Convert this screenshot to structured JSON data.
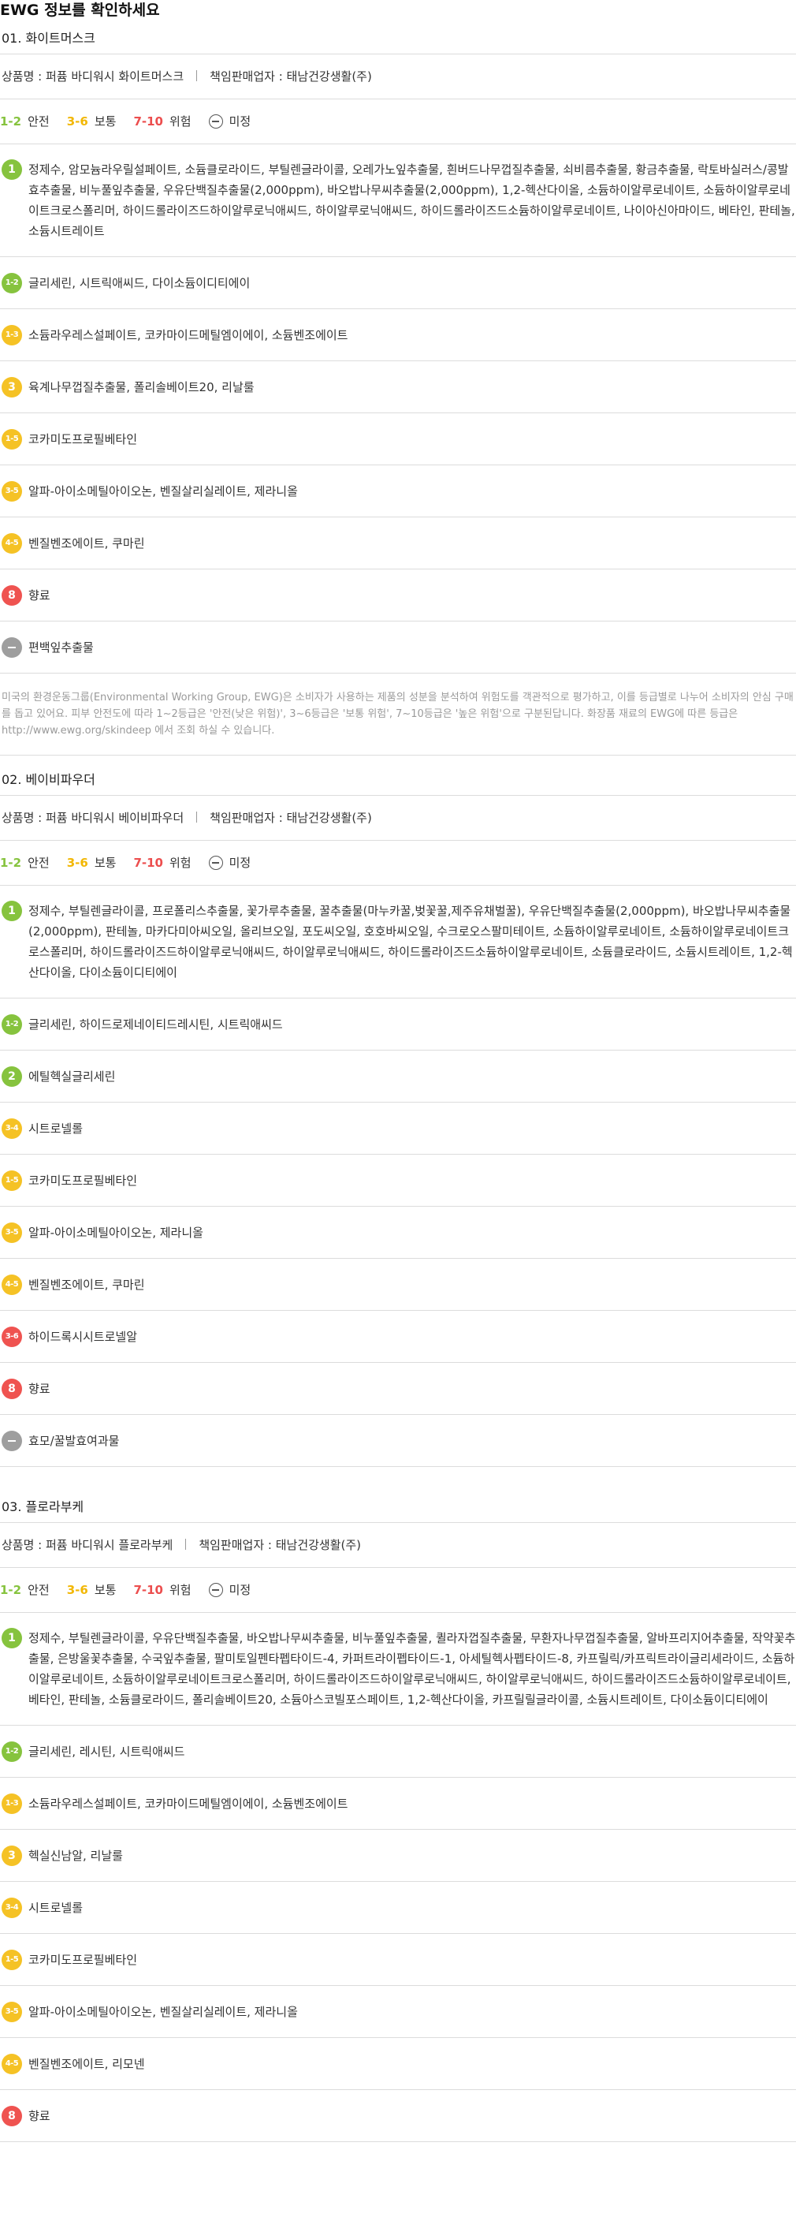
{
  "page_title": "EWG 정보를 확인하세요",
  "legend": {
    "safe_range": "1-2",
    "safe_label": "안전",
    "medium_range": "3-6",
    "medium_label": "보통",
    "danger_range": "7-10",
    "danger_label": "위험",
    "undetermined_label": "미정"
  },
  "colors": {
    "green": "#86c33e",
    "yellow": "#f5c225",
    "red": "#ef5350",
    "gray": "#9e9e9e"
  },
  "note": "미국의 환경운동그룹(Environmental Working Group, EWG)은 소비자가 사용하는 제품의 성분을 분석하여 위험도를 객관적으로 평가하고, 이를 등급별로 나누어 소비자의 안심 구매를 돕고 있어요. 피부 안전도에 따라 1~2등급은 '안전(낮은 위험)', 3~6등급은 '보통 위험', 7~10등급은 '높은 위험'으로 구분된답니다. 화장품 재료의 EWG에 따른 등급은 http://www.ewg.org/skindeep 에서 조회 하실 수 있습니다.",
  "sections": [
    {
      "heading": "01. 화이트머스크",
      "product": "상품명 : 퍼퓸 바디워시 화이트머스크",
      "seller": "책임판매업자 : 태남건강생활(주)",
      "rows": [
        {
          "grade": "1",
          "color": "green",
          "text": "정제수, 암모늄라우릴설페이트, 소듐클로라이드, 부틸렌글라이콜, 오레가노잎추출물, 흰버드나무껍질추출물, 쇠비름추출물, 황금추출물, 락토바실러스/콩발효추출물, 비누풀잎추출물, 우유단백질추출물(2,000ppm), 바오밥나무씨추출물(2,000ppm), 1,2-헥산다이올, 소듐하이알루로네이트, 소듐하이알루로네이트크로스폴리머, 하이드롤라이즈드하이알루로닉애씨드, 하이알루로닉애씨드, 하이드롤라이즈드소듐하이알루로네이트, 나이아신아마이드, 베타인, 판테놀, 소듐시트레이트"
        },
        {
          "grade": "1-2",
          "color": "green",
          "text": "글리세린, 시트릭애씨드, 다이소듐이디티에이"
        },
        {
          "grade": "1-3",
          "color": "yellow",
          "text": "소듐라우레스설페이트, 코카마이드메틸엠이에이, 소듐벤조에이트"
        },
        {
          "grade": "3",
          "color": "yellow",
          "text": "육계나무껍질추출물, 폴리솔베이트20, 리날룰"
        },
        {
          "grade": "1-5",
          "color": "yellow",
          "text": "코카미도프로필베타인"
        },
        {
          "grade": "3-5",
          "color": "yellow",
          "text": "알파-아이소메틸아이오논, 벤질살리실레이트, 제라니올"
        },
        {
          "grade": "4-5",
          "color": "yellow",
          "text": "벤질벤조에이트, 쿠마린"
        },
        {
          "grade": "8",
          "color": "red",
          "text": "향료"
        },
        {
          "grade": "",
          "color": "gray",
          "text": "편백잎추출물"
        }
      ]
    },
    {
      "heading": "02. 베이비파우더",
      "product": "상품명 : 퍼퓸 바디워시 베이비파우더",
      "seller": "책임판매업자 : 태남건강생활(주)",
      "rows": [
        {
          "grade": "1",
          "color": "green",
          "text": "정제수, 부틸렌글라이콜, 프로폴리스추출물, 꽃가루추출물, 꿀추출물(마누카꿀,벚꽃꿀,제주유채벌꿀), 우유단백질추출물(2,000ppm), 바오밥나무씨추출물(2,000ppm), 판테놀, 마카다미아씨오일, 올리브오일, 포도씨오일, 호호바씨오일, 수크로오스팔미테이트, 소듐하이알루로네이트, 소듐하이알루로네이트크로스폴리머, 하이드롤라이즈드하이알루로닉애씨드, 하이알루로닉애씨드, 하이드롤라이즈드소듐하이알루로네이트, 소듐클로라이드, 소듐시트레이트, 1,2-헥산다이올, 다이소듐이디티에이"
        },
        {
          "grade": "1-2",
          "color": "green",
          "text": "글리세린, 하이드로제네이티드레시틴, 시트릭애씨드"
        },
        {
          "grade": "2",
          "color": "green",
          "text": "에틸헥실글리세린"
        },
        {
          "grade": "3-4",
          "color": "yellow",
          "text": "시트로넬롤"
        },
        {
          "grade": "1-5",
          "color": "yellow",
          "text": "코카미도프로필베타인"
        },
        {
          "grade": "3-5",
          "color": "yellow",
          "text": "알파-아이소메틸아이오논, 제라니올"
        },
        {
          "grade": "4-5",
          "color": "yellow",
          "text": "벤질벤조에이트, 쿠마린"
        },
        {
          "grade": "3-6",
          "color": "red",
          "text": "하이드록시시트로넬알"
        },
        {
          "grade": "8",
          "color": "red",
          "text": "향료"
        },
        {
          "grade": "",
          "color": "gray",
          "text": "효모/꿀발효여과물"
        }
      ]
    },
    {
      "heading": "03. 플로라부케",
      "product": "상품명 : 퍼퓸 바디워시 플로라부케",
      "seller": "책임판매업자 : 태남건강생활(주)",
      "rows": [
        {
          "grade": "1",
          "color": "green",
          "text": "정제수, 부틸렌글라이콜, 우유단백질추출물, 바오밥나무씨추출물, 비누풀잎추출물, 퀼라자껍질추출물, 무환자나무껍질추출물, 알바프리지어추출물, 작약꽃추출물, 은방울꽃추출물, 수국잎추출물, 팔미토일펜타펩타이드-4, 카퍼트라이펩타이드-1, 아세틸헥사펩타이드-8, 카프릴릭/카프릭트라이글리세라이드, 소듐하이알루로네이트, 소듐하이알루로네이트크로스폴리머, 하이드롤라이즈드하이알루로닉애씨드, 하이알루로닉애씨드, 하이드롤라이즈드소듐하이알루로네이트, 베타인, 판테놀, 소듐클로라이드, 폴리솔베이트20, 소듐아스코빌포스페이트, 1,2-헥산다이올, 카프릴릴글라이콜, 소듐시트레이트, 다이소듐이디티에이"
        },
        {
          "grade": "1-2",
          "color": "green",
          "text": "글리세린, 레시틴, 시트릭애씨드"
        },
        {
          "grade": "1-3",
          "color": "yellow",
          "text": "소듐라우레스설페이트, 코카마이드메틸엠이에이, 소듐벤조에이트"
        },
        {
          "grade": "3",
          "color": "yellow",
          "text": "헥실신남알, 리날룰"
        },
        {
          "grade": "3-4",
          "color": "yellow",
          "text": "시트로넬롤"
        },
        {
          "grade": "1-5",
          "color": "yellow",
          "text": "코카미도프로필베타인"
        },
        {
          "grade": "3-5",
          "color": "yellow",
          "text": "알파-아이소메틸아이오논, 벤질살리실레이트, 제라니올"
        },
        {
          "grade": "4-5",
          "color": "yellow",
          "text": "벤질벤조에이트, 리모넨"
        },
        {
          "grade": "8",
          "color": "red",
          "text": "향료"
        }
      ]
    }
  ]
}
